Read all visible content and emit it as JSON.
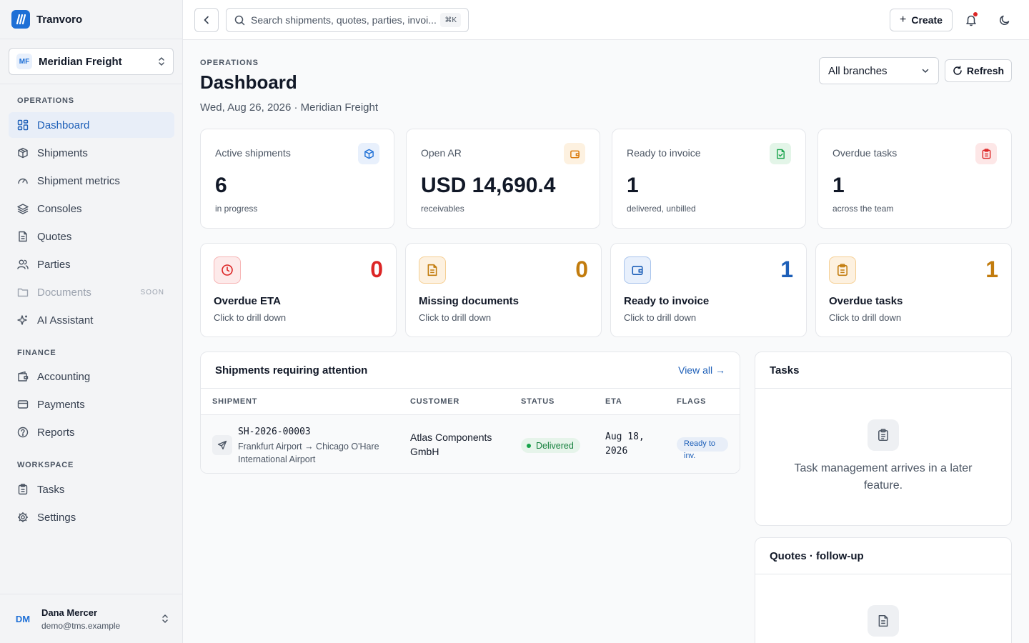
{
  "brand": {
    "name": "Tranvoro"
  },
  "org": {
    "initials": "MF",
    "name": "Meridian Freight"
  },
  "sidebar": {
    "sections": {
      "operations": "OPERATIONS",
      "finance": "FINANCE",
      "workspace": "WORKSPACE"
    },
    "operations": [
      {
        "label": "Dashboard",
        "icon": "dashboard-icon",
        "active": true
      },
      {
        "label": "Shipments",
        "icon": "package-icon"
      },
      {
        "label": "Shipment metrics",
        "icon": "gauge-icon"
      },
      {
        "label": "Consoles",
        "icon": "layers-icon"
      },
      {
        "label": "Quotes",
        "icon": "document-icon"
      },
      {
        "label": "Parties",
        "icon": "users-icon"
      },
      {
        "label": "Documents",
        "icon": "folder-icon",
        "disabled": true,
        "badge": "SOON"
      },
      {
        "label": "AI Assistant",
        "icon": "sparkles-icon"
      }
    ],
    "finance": [
      {
        "label": "Accounting",
        "icon": "wallet-icon"
      },
      {
        "label": "Payments",
        "icon": "credit-card-icon"
      },
      {
        "label": "Reports",
        "icon": "help-circle-icon"
      }
    ],
    "workspace": [
      {
        "label": "Tasks",
        "icon": "clipboard-icon"
      },
      {
        "label": "Settings",
        "icon": "gear-icon"
      }
    ]
  },
  "user": {
    "initials": "DM",
    "name": "Dana Mercer",
    "email": "demo@tms.example"
  },
  "topbar": {
    "search_placeholder": "Search shipments, quotes, parties, invoi...",
    "shortcut": "⌘K",
    "create_label": "Create"
  },
  "header": {
    "eyebrow": "OPERATIONS",
    "title": "Dashboard",
    "subtitle": "Wed, Aug 26, 2026 · Meridian Freight",
    "branch_filter": "All branches",
    "refresh_label": "Refresh"
  },
  "kpis": [
    {
      "label": "Active shipments",
      "value": "6",
      "sub": "in progress",
      "icon": "package-icon",
      "color": "#1d6fd6",
      "bg": "#e8f0fc"
    },
    {
      "label": "Open AR",
      "value": "USD 14,690.4",
      "sub": "receivables",
      "icon": "wallet-icon",
      "color": "#d97706",
      "bg": "#fdf1e0"
    },
    {
      "label": "Ready to invoice",
      "value": "1",
      "sub": "delivered, unbilled",
      "icon": "file-check-icon",
      "color": "#16a34a",
      "bg": "#e3f5e8"
    },
    {
      "label": "Overdue tasks",
      "value": "1",
      "sub": "across the team",
      "icon": "clipboard-icon",
      "color": "#dc2626",
      "bg": "#fde7e7"
    }
  ],
  "drilldowns": [
    {
      "title": "Overdue ETA",
      "count": "0",
      "sub": "Click to drill down",
      "icon": "clock-icon",
      "color": "#dc2626",
      "bg": "#fdeaea",
      "border": "#f6b4b4"
    },
    {
      "title": "Missing documents",
      "count": "0",
      "sub": "Click to drill down",
      "icon": "document-icon",
      "color": "#c27c0e",
      "bg": "#fdf1e0",
      "border": "#f5cf94"
    },
    {
      "title": "Ready to invoice",
      "count": "1",
      "sub": "Click to drill down",
      "icon": "wallet-icon",
      "color": "#1d5fb8",
      "bg": "#e8f0fc",
      "border": "#a9c4ec"
    },
    {
      "title": "Overdue tasks",
      "count": "1",
      "sub": "Click to drill down",
      "icon": "clipboard-icon",
      "color": "#c27c0e",
      "bg": "#fdf1e0",
      "border": "#f5cf94"
    }
  ],
  "attention": {
    "title": "Shipments requiring attention",
    "view_all": "View all →",
    "columns": [
      "SHIPMENT",
      "CUSTOMER",
      "STATUS",
      "ETA",
      "FLAGS"
    ],
    "rows": [
      {
        "id": "SH-2026-00003",
        "route": "Frankfurt Airport → Chicago O'Hare International Airport",
        "mode_icon": "plane-icon",
        "customer": "Atlas Components GmbH",
        "status": "Delivered",
        "eta": "Aug 18, 2026",
        "flag": "Ready to inv."
      }
    ]
  },
  "tasks": {
    "title": "Tasks",
    "empty": "Task management arrives in a later feature."
  },
  "quotes": {
    "title": "Quotes · follow-up"
  }
}
